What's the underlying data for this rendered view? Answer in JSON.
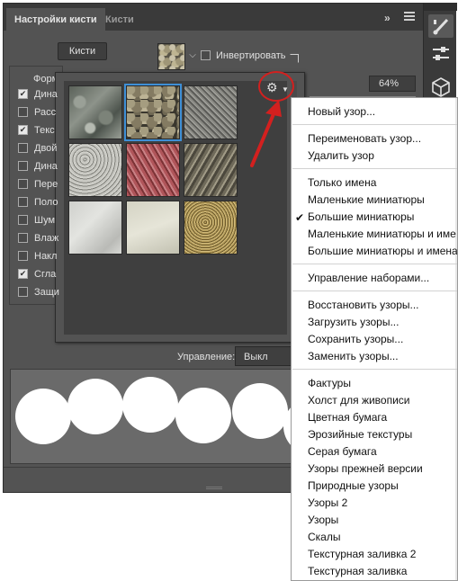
{
  "panel": {
    "tabs": [
      "Настройки кисти",
      "Кисти"
    ],
    "collapse": "»",
    "brushes_button": "Кисти",
    "invert_label": "Инвертировать",
    "options_header": "Форм",
    "options": [
      {
        "label": "Дина",
        "checked": true
      },
      {
        "label": "Расс",
        "checked": false
      },
      {
        "label": "Текс",
        "checked": true
      },
      {
        "label": "Двой",
        "checked": false
      },
      {
        "label": "Дина",
        "checked": false
      },
      {
        "label": "Пере",
        "checked": false
      },
      {
        "label": "Поло",
        "checked": false
      },
      {
        "label": "Шум",
        "checked": false
      },
      {
        "label": "Влаж",
        "checked": false
      },
      {
        "label": "Накл",
        "checked": false
      },
      {
        "label": "Сгла",
        "checked": true
      },
      {
        "label": "Защи",
        "checked": false
      }
    ],
    "percent": "64%",
    "control_label": "Управление:",
    "control_value": "Выкл"
  },
  "picker": {
    "patterns": [
      "pattern-1",
      "pattern-2",
      "pattern-3",
      "pattern-4",
      "pattern-5",
      "pattern-6",
      "pattern-7",
      "pattern-8",
      "pattern-9"
    ],
    "selected_index": 1,
    "gear_icon": "gear-icon"
  },
  "colors": {
    "panel": "#535353",
    "annotation": "#d3201f",
    "selection": "#3e8fd6"
  },
  "menu": {
    "group1": [
      "Новый узор..."
    ],
    "group2": [
      "Переименовать узор...",
      "Удалить узор"
    ],
    "group3": [
      "Только имена",
      "Маленькие миниатюры",
      "Большие миниатюры",
      "Маленькие миниатюры и име",
      "Большие миниатюры и имена"
    ],
    "checked": "Большие миниатюры",
    "group4": [
      "Управление наборами..."
    ],
    "group5": [
      "Восстановить узоры...",
      "Загрузить узоры...",
      "Сохранить узоры...",
      "Заменить узоры..."
    ],
    "group6": [
      "Фактуры",
      "Холст для живописи",
      "Цветная бумага",
      "Эрозийные текстуры",
      "Серая бумага",
      "Узоры прежней версии",
      "Природные узоры",
      "Узоры 2",
      "Узоры",
      "Скалы",
      "Текстурная заливка 2",
      "Текстурная заливка"
    ]
  }
}
